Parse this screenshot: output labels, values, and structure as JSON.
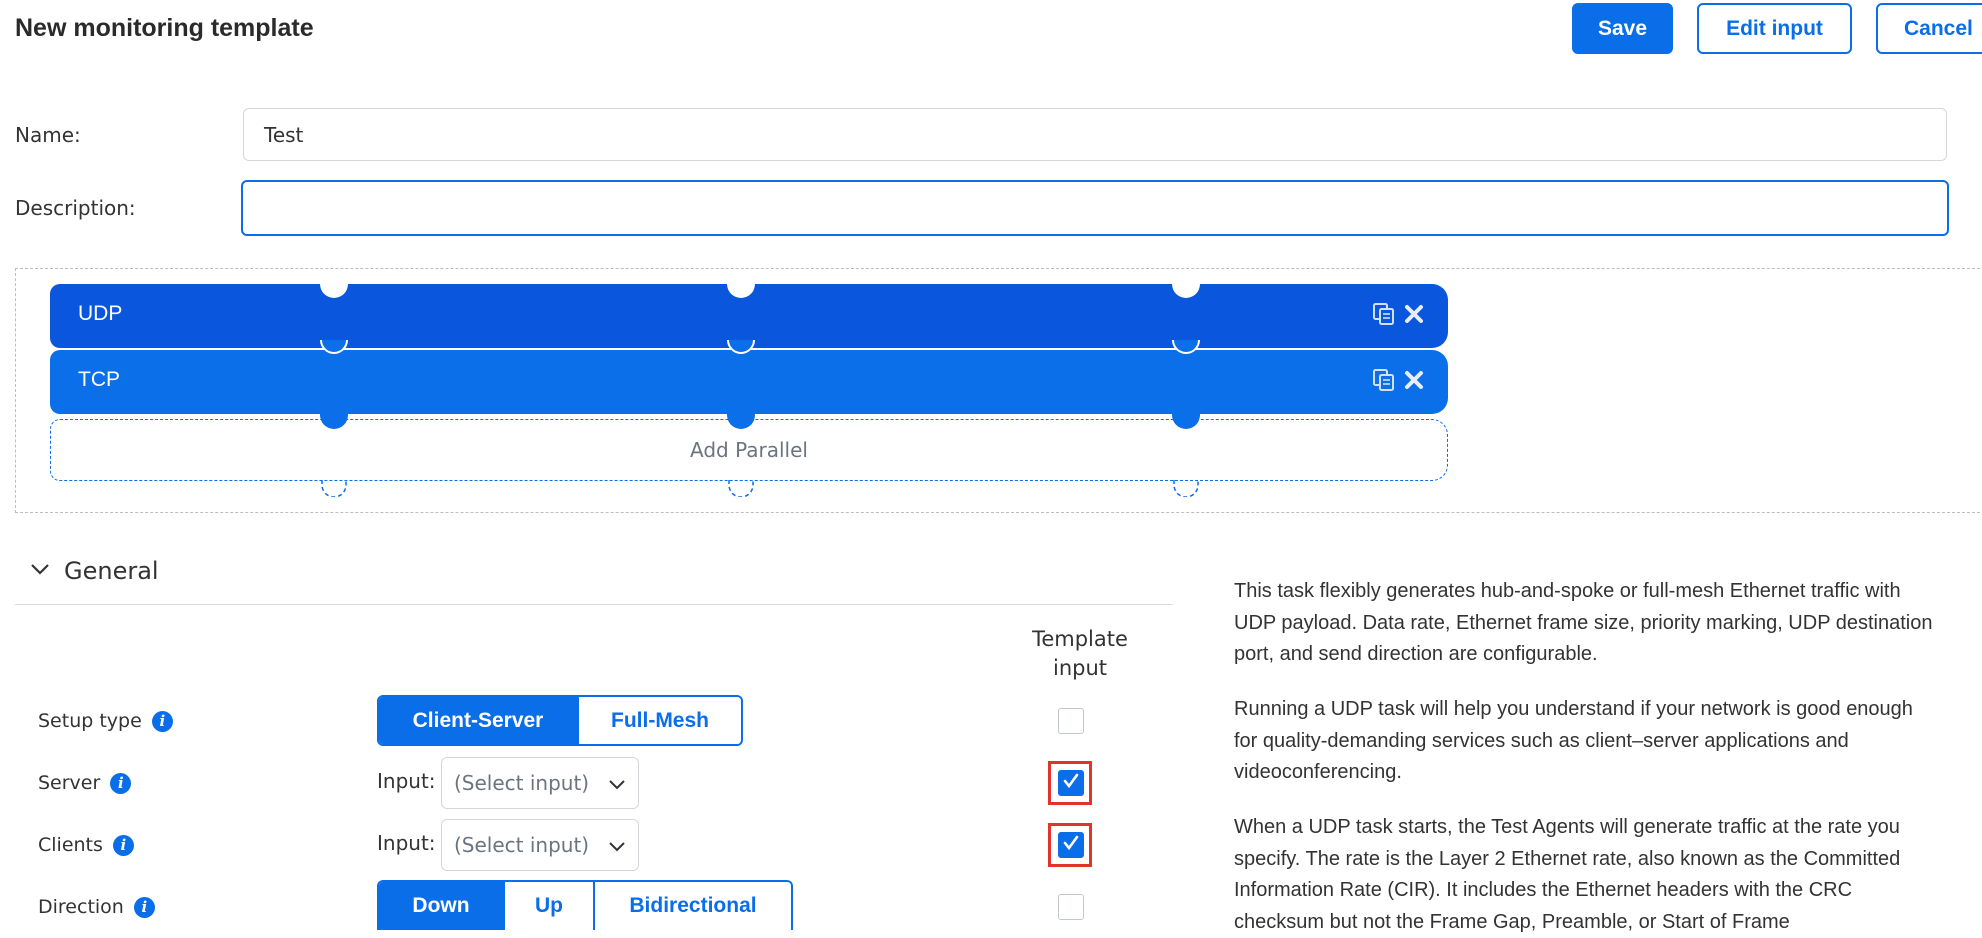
{
  "header": {
    "title": "New monitoring template",
    "save_label": "Save",
    "edit_input_label": "Edit input",
    "cancel_label": "Cancel"
  },
  "form": {
    "name_label": "Name:",
    "name_value": "Test",
    "description_label": "Description:",
    "description_value": ""
  },
  "canvas": {
    "lanes": [
      {
        "label": "UDP",
        "color": "#0a56dc"
      },
      {
        "label": "TCP",
        "color": "#0b6fe9"
      }
    ],
    "add_parallel_label": "Add Parallel"
  },
  "general": {
    "section_title": "General",
    "template_input_header": "Template\ninput",
    "rows": [
      {
        "label": "Setup type",
        "options": [
          "Client-Server",
          "Full-Mesh"
        ],
        "selected": "Client-Server",
        "template_input": false
      },
      {
        "label": "Server",
        "input_label": "Input:",
        "placeholder": "(Select input)",
        "template_input": true
      },
      {
        "label": "Clients",
        "input_label": "Input:",
        "placeholder": "(Select input)",
        "template_input": true
      },
      {
        "label": "Direction",
        "options": [
          "Down",
          "Up",
          "Bidirectional"
        ],
        "selected": "Down",
        "template_input": false
      }
    ]
  },
  "description_panel": {
    "p1": "This task flexibly generates hub-and-spoke or full-mesh Ethernet traffic with UDP payload. Data rate, Ethernet frame size, priority marking, UDP destination port, and send direction are configurable.",
    "p2": "Running a UDP task will help you understand if your network is good enough for quality-demanding services such as client–server applications and videoconferencing.",
    "p3": "When a UDP task starts, the Test Agents will generate traffic at the rate you specify. The rate is the Layer 2 Ethernet rate, also known as the Committed Information Rate (CIR). It includes the Ethernet headers with the CRC checksum but not the Frame Gap, Preamble, or Start of Frame"
  },
  "colors": {
    "accent": "#0a6ee8",
    "highlight": "#e0352b"
  }
}
